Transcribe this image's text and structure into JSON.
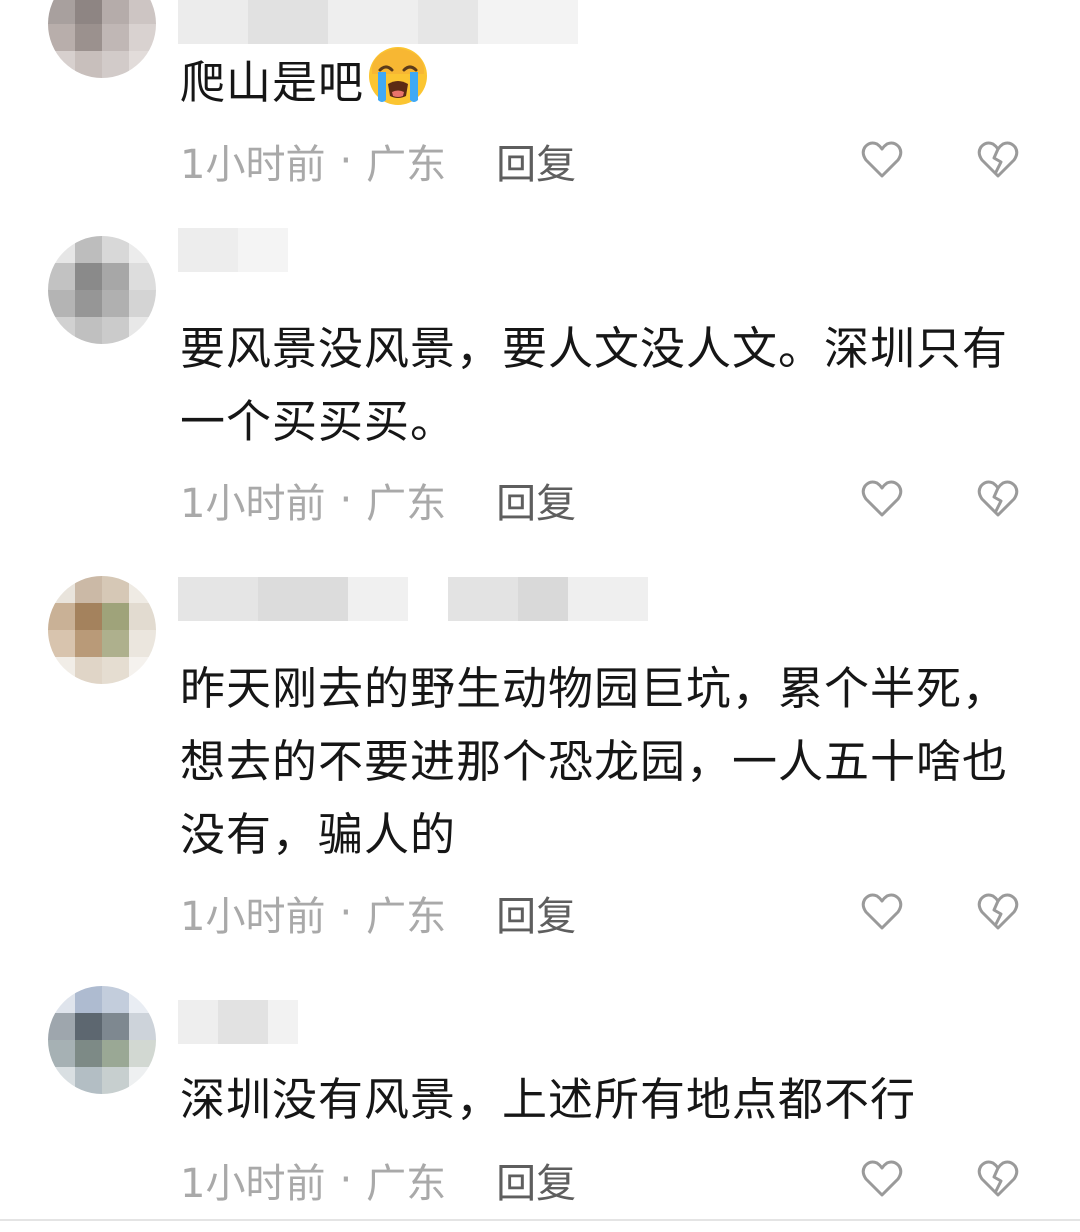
{
  "comments": [
    {
      "text": "爬山是吧",
      "emoji": "loudly-crying-face",
      "time": "1小时前",
      "separator": "·",
      "location": "广东",
      "reply": "回复"
    },
    {
      "text": "要风景没风景，要人文没人文。深圳只有一个买买买。",
      "time": "1小时前",
      "separator": "·",
      "location": "广东",
      "reply": "回复"
    },
    {
      "text": "昨天刚去的野生动物园巨坑，累个半死，想去的不要进那个恐龙园，一人五十啥也没有，骗人的",
      "time": "1小时前",
      "separator": "·",
      "location": "广东",
      "reply": "回复"
    },
    {
      "text": "深圳没有风景，上述所有地点都不行",
      "time": "1小时前",
      "separator": "·",
      "location": "广东",
      "reply": "回复"
    }
  ],
  "icons": {
    "like": "heart-outline-icon",
    "dislike": "broken-heart-outline-icon"
  },
  "colors": {
    "meta": "#a9a9a9",
    "reply": "#5e5e5e",
    "text": "#161616",
    "icon": "#9a9a9a"
  }
}
